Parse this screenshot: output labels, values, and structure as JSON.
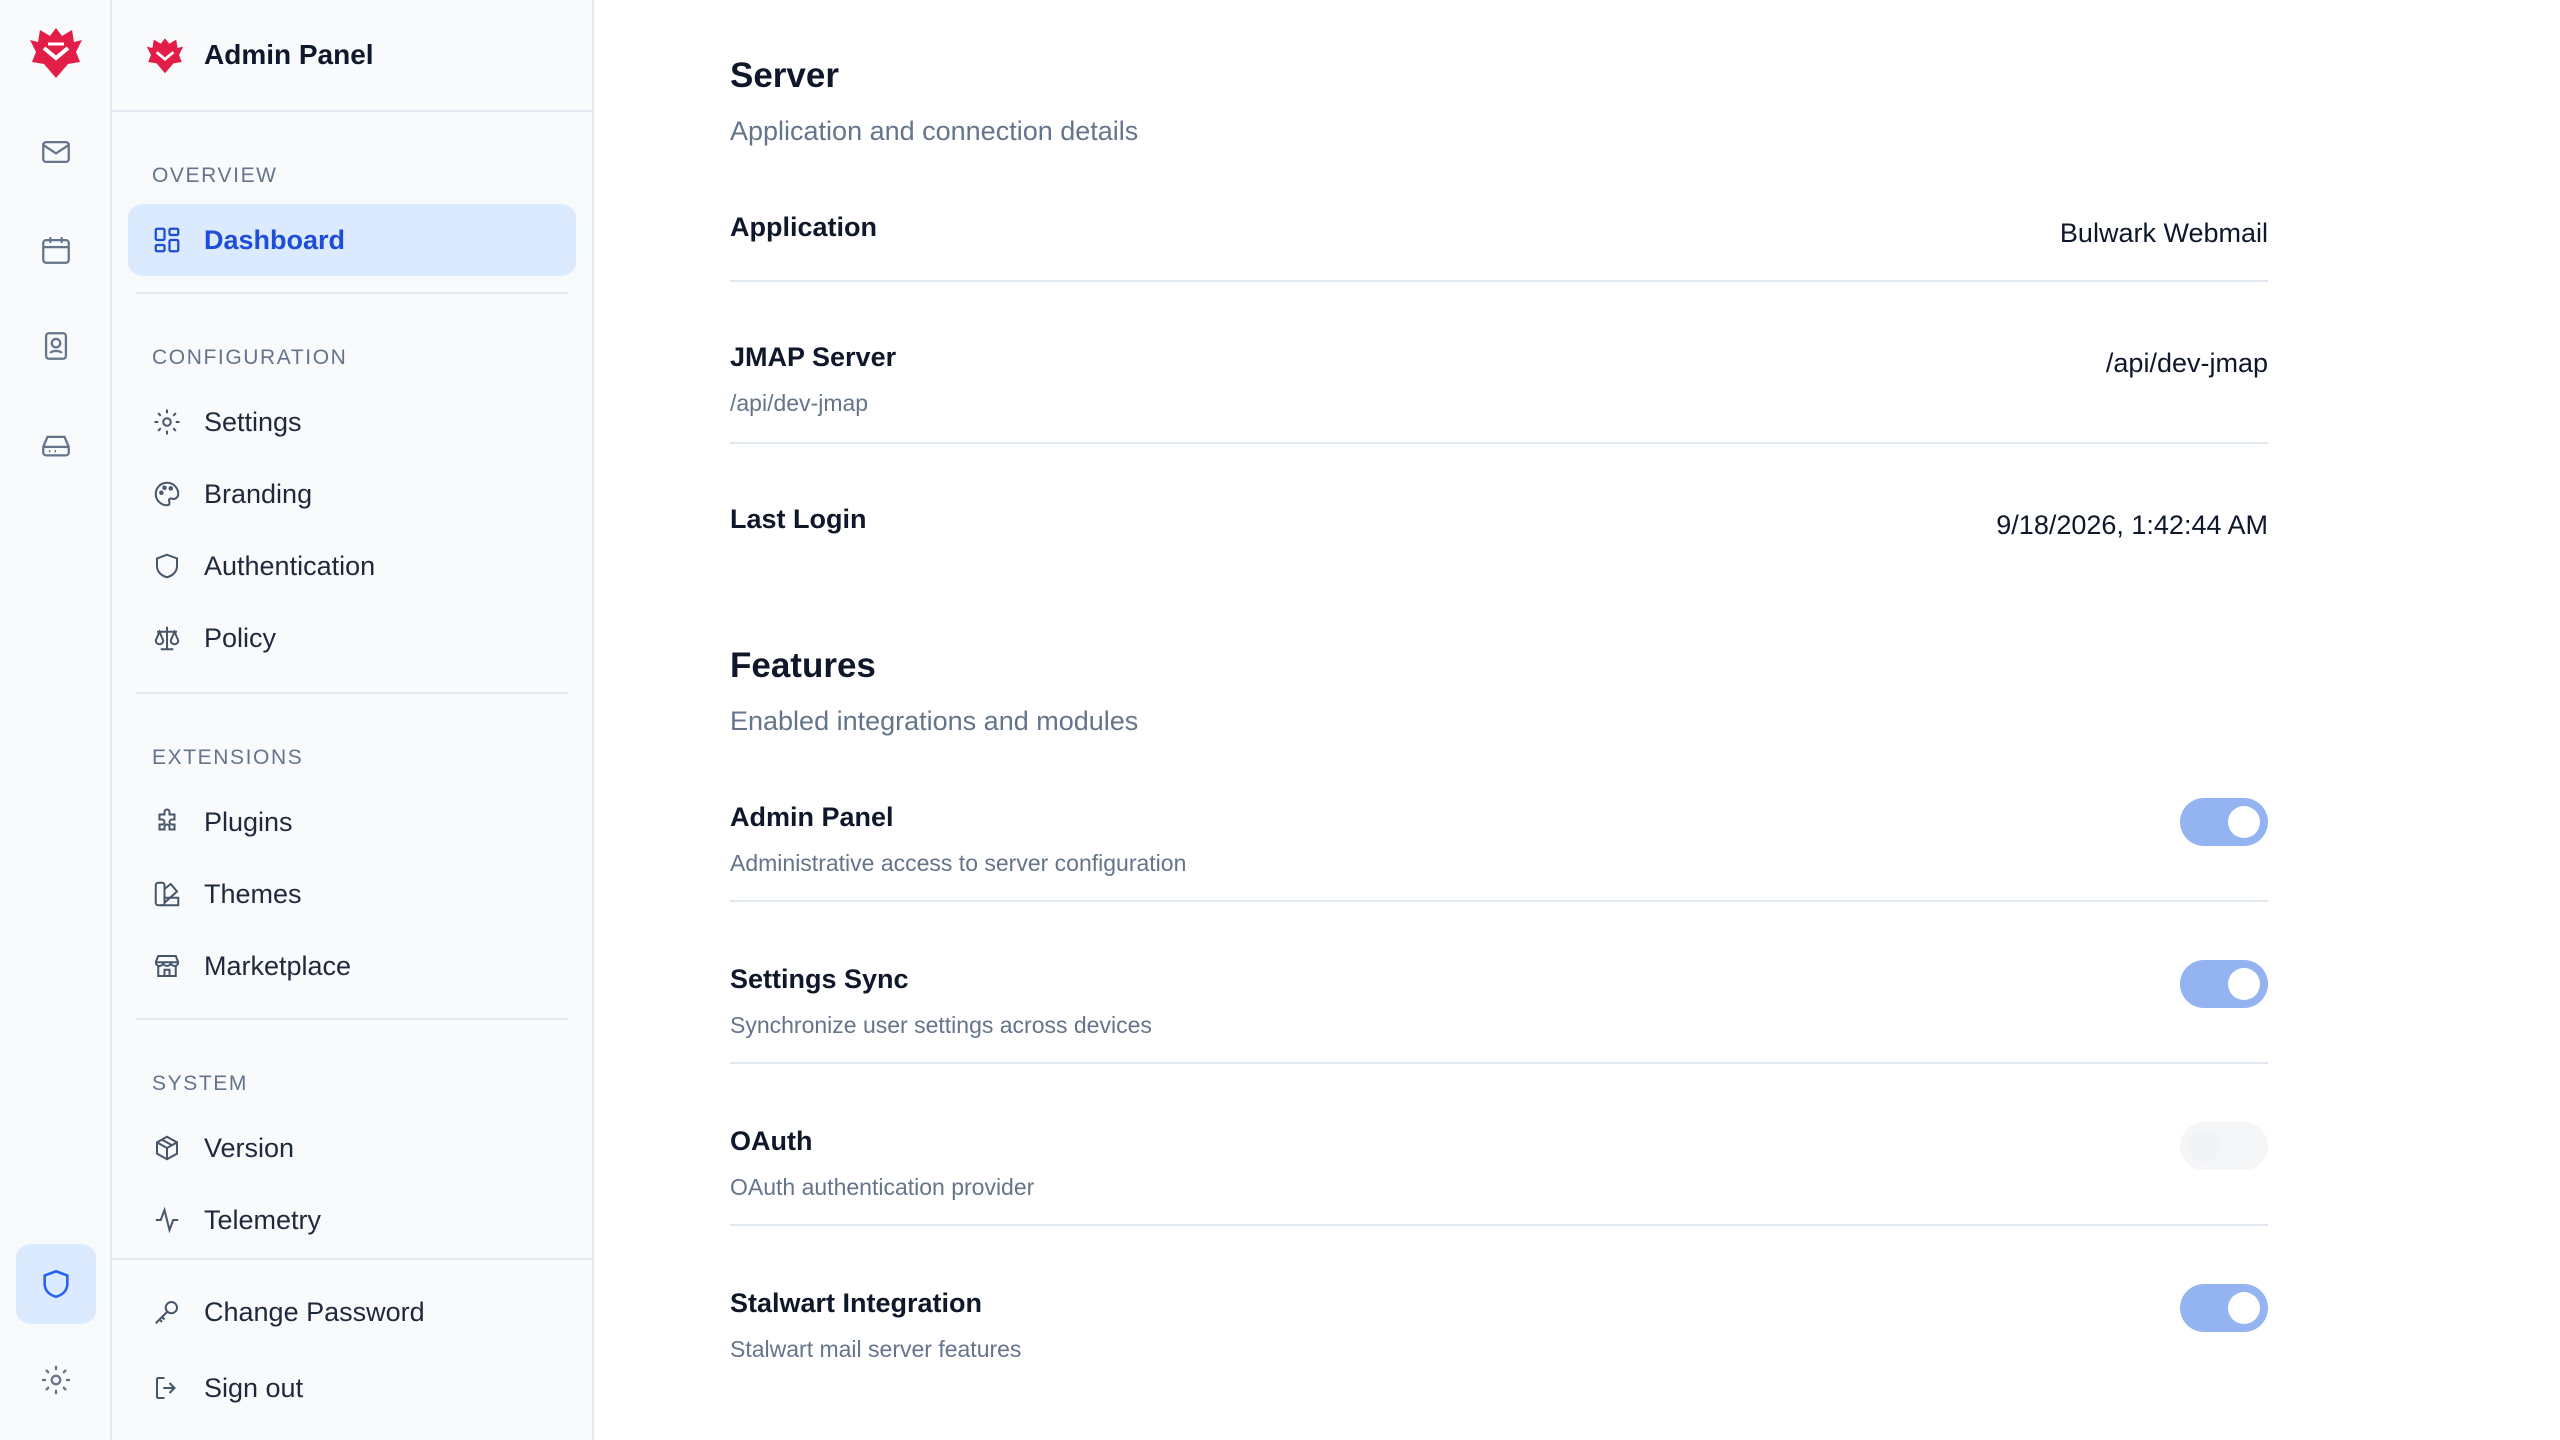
{
  "app": {
    "title": "Admin Panel"
  },
  "rail": {
    "items": [
      {
        "icon": "mail-icon"
      },
      {
        "icon": "calendar-icon"
      },
      {
        "icon": "contacts-icon"
      },
      {
        "icon": "inbox-drive-icon"
      },
      {
        "icon": "shield-icon",
        "active": true
      },
      {
        "icon": "gear-icon"
      }
    ]
  },
  "sidebar": {
    "sections": [
      {
        "label": "OVERVIEW",
        "items": [
          {
            "label": "Dashboard",
            "icon": "dashboard-icon",
            "active": true
          }
        ]
      },
      {
        "label": "CONFIGURATION",
        "items": [
          {
            "label": "Settings",
            "icon": "gear-icon"
          },
          {
            "label": "Branding",
            "icon": "palette-icon"
          },
          {
            "label": "Authentication",
            "icon": "shield-icon"
          },
          {
            "label": "Policy",
            "icon": "scale-icon"
          }
        ]
      },
      {
        "label": "EXTENSIONS",
        "items": [
          {
            "label": "Plugins",
            "icon": "puzzle-icon"
          },
          {
            "label": "Themes",
            "icon": "swatch-icon"
          },
          {
            "label": "Marketplace",
            "icon": "store-icon"
          }
        ]
      },
      {
        "label": "SYSTEM",
        "items": [
          {
            "label": "Version",
            "icon": "package-icon"
          },
          {
            "label": "Telemetry",
            "icon": "activity-icon"
          }
        ]
      }
    ],
    "footer": {
      "change_password": "Change Password",
      "sign_out": "Sign out"
    }
  },
  "server": {
    "title": "Server",
    "subtitle": "Application and connection details",
    "rows": [
      {
        "label": "Application",
        "desc": "",
        "value": "Bulwark Webmail"
      },
      {
        "label": "JMAP Server",
        "desc": "/api/dev-jmap",
        "value": "/api/dev-jmap"
      },
      {
        "label": "Last Login",
        "desc": "",
        "value": "9/18/2026, 1:42:44 AM"
      }
    ]
  },
  "features": {
    "title": "Features",
    "subtitle": "Enabled integrations and modules",
    "rows": [
      {
        "label": "Admin Panel",
        "desc": "Administrative access to server configuration",
        "enabled": true
      },
      {
        "label": "Settings Sync",
        "desc": "Synchronize user settings across devices",
        "enabled": true
      },
      {
        "label": "OAuth",
        "desc": "OAuth authentication provider",
        "enabled": false
      },
      {
        "label": "Stalwart Integration",
        "desc": "Stalwart mail server features",
        "enabled": true
      }
    ]
  },
  "colors": {
    "accent": "#2563eb",
    "active_bg": "#dbeafe",
    "toggle_on": "#93b4f0",
    "brand": "#e11d48"
  }
}
